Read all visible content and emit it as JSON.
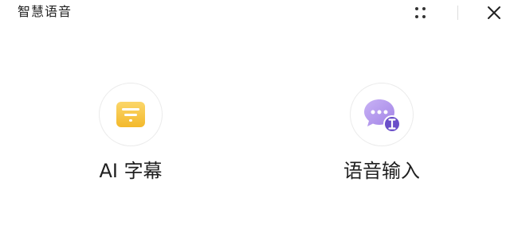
{
  "window": {
    "title": "智慧语音"
  },
  "toolbar": {
    "grid_icon": "grid-dots-icon",
    "close_icon": "close-icon"
  },
  "features": [
    {
      "label": "AI 字幕",
      "icon": "subtitle-card-icon",
      "color": "#f7c843"
    },
    {
      "label": "语音输入",
      "icon": "chat-bubble-input-icon",
      "color": "#a98be8"
    }
  ]
}
